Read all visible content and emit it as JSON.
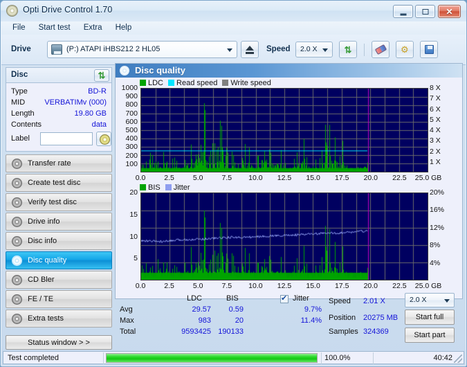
{
  "window": {
    "title": "Opti Drive Control 1.70",
    "icon": "disc-icon",
    "minimize": "minimize-icon",
    "maximize": "maximize-icon",
    "close": "✕"
  },
  "menu": {
    "items": [
      "File",
      "Start test",
      "Extra",
      "Help"
    ]
  },
  "toolbar": {
    "drive_label": "Drive",
    "drive_value": "(P:)  ATAPI iHBS212  2 HL05",
    "eject_icon": "eject-icon",
    "speed_label": "Speed",
    "speed_value": "2.0 X",
    "refresh_icon": "refresh-icon",
    "erase_icon": "erase-icon",
    "tools_icon": "tools-icon",
    "save_icon": "save-icon"
  },
  "disc": {
    "header": "Disc",
    "refresh_icon": "refresh-icon",
    "rows": [
      {
        "key": "Type",
        "value": "BD-R"
      },
      {
        "key": "MID",
        "value": "VERBATIMv (000)"
      },
      {
        "key": "Length",
        "value": "19.80 GB"
      },
      {
        "key": "Contents",
        "value": "data"
      }
    ],
    "label_key": "Label",
    "label_value": "",
    "label_placeholder": ""
  },
  "nav": {
    "items": [
      {
        "label": "Transfer rate",
        "selected": false
      },
      {
        "label": "Create test disc",
        "selected": false
      },
      {
        "label": "Verify test disc",
        "selected": false
      },
      {
        "label": "Drive info",
        "selected": false
      },
      {
        "label": "Disc info",
        "selected": false
      },
      {
        "label": "Disc quality",
        "selected": true
      },
      {
        "label": "CD Bler",
        "selected": false
      },
      {
        "label": "FE / TE",
        "selected": false
      },
      {
        "label": "Extra tests",
        "selected": false
      }
    ],
    "status_window": "Status window > >"
  },
  "panel": {
    "title": "Disc quality",
    "icon": "disc-quality-icon"
  },
  "stats": {
    "col_headers": [
      "LDC",
      "BIS",
      "Jitter"
    ],
    "jitter_checked": true,
    "rows": [
      {
        "label": "Avg",
        "ldc": "29.57",
        "bis": "0.59",
        "jitter": "9.7%"
      },
      {
        "label": "Max",
        "ldc": "983",
        "bis": "20",
        "jitter": "11.4%"
      },
      {
        "label": "Total",
        "ldc": "9593425",
        "bis": "190133",
        "jitter": ""
      }
    ],
    "right": [
      {
        "label": "Speed",
        "value": "2.01 X"
      },
      {
        "label": "Position",
        "value": "20275 MB"
      },
      {
        "label": "Samples",
        "value": "324369"
      }
    ],
    "speed_select": "2.0 X",
    "start_full": "Start full",
    "start_part": "Start part"
  },
  "statusbar": {
    "message": "Test completed",
    "percent": "100.0%",
    "progress_value": 100,
    "elapsed": "40:42"
  },
  "colors": {
    "ldc": "#00a400",
    "read_speed": "#00e5ff",
    "write_speed": "#808080",
    "bis": "#00a400",
    "jitter": "#8f9ef0",
    "plot_bg": "#000060",
    "marker": "#c000c0"
  },
  "chart_data": [
    {
      "type": "area",
      "name": "quality-chart-ldc",
      "title": "",
      "legend": [
        {
          "label": "LDC",
          "color": "#00a400"
        },
        {
          "label": "Read speed",
          "color": "#00e5ff"
        },
        {
          "label": "Write speed",
          "color": "#808080"
        }
      ],
      "legend_position": "top-left",
      "xlabel": "GB",
      "xlim": [
        0,
        25
      ],
      "xticks": [
        "0.0",
        "2.5",
        "5.0",
        "7.5",
        "10.0",
        "12.5",
        "15.0",
        "17.5",
        "20.0",
        "22.5",
        "25.0 GB"
      ],
      "ylabel_left": "LDC",
      "ylim": [
        0,
        1000
      ],
      "yticks_left": [
        "1000",
        "900",
        "800",
        "700",
        "600",
        "500",
        "400",
        "300",
        "200",
        "100"
      ],
      "ylabel_right": "Speed",
      "ylim_right": [
        0,
        8
      ],
      "yticks_right": [
        "8 X",
        "7 X",
        "6 X",
        "5 X",
        "4 X",
        "3 X",
        "2 X",
        "1 X"
      ],
      "grid": true,
      "data_end_x": 19.8,
      "marker_x": 19.8,
      "series": [
        {
          "name": "LDC",
          "color": "#00a400",
          "type": "area-spikes",
          "x": [
            0.0,
            0.25,
            0.5,
            0.75,
            1.0,
            1.25,
            1.5,
            1.75,
            2.0,
            2.25,
            2.5,
            2.75,
            3.0,
            3.25,
            3.5,
            3.75,
            4.0,
            4.25,
            4.5,
            4.75,
            5.0,
            5.25,
            5.5,
            5.75,
            6.0,
            6.25,
            6.5,
            6.75,
            7.0,
            7.25,
            7.5,
            7.75,
            8.0,
            8.25,
            8.5,
            8.75,
            9.0,
            9.25,
            9.5,
            9.75,
            10.0,
            10.25,
            10.5,
            10.75,
            11.0,
            11.25,
            11.5,
            11.75,
            12.0,
            12.25,
            12.5,
            12.75,
            13.0,
            13.25,
            13.5,
            13.75,
            14.0,
            14.25,
            14.5,
            14.75,
            15.0,
            15.25,
            15.5,
            15.75,
            16.0,
            16.25,
            16.5,
            16.75,
            17.0,
            17.25,
            17.5,
            17.75,
            18.0,
            18.25,
            18.5,
            18.75,
            19.0,
            19.25,
            19.5,
            19.8
          ],
          "values": [
            60,
            180,
            120,
            260,
            300,
            575,
            200,
            150,
            330,
            110,
            90,
            200,
            170,
            230,
            140,
            120,
            300,
            440,
            830,
            380,
            300,
            420,
            980,
            300,
            260,
            420,
            970,
            760,
            600,
            590,
            710,
            430,
            220,
            130,
            90,
            180,
            260,
            580,
            230,
            300,
            180,
            200,
            220,
            420,
            330,
            250,
            430,
            360,
            290,
            400,
            430,
            200,
            140,
            290,
            330,
            180,
            420,
            500,
            180,
            90,
            120,
            180,
            390,
            250,
            720,
            520,
            680,
            560,
            480,
            500,
            430,
            300,
            140,
            90,
            60,
            80,
            120,
            160,
            200,
            120
          ]
        },
        {
          "name": "Read speed",
          "color": "#00e5ff",
          "type": "line",
          "constant_value_x": 2.01,
          "x": [
            0.0,
            19.8
          ],
          "values": [
            2.01,
            2.01
          ]
        },
        {
          "name": "Write speed",
          "color": "#808080",
          "type": "line",
          "x": [],
          "values": []
        }
      ]
    },
    {
      "type": "area",
      "name": "quality-chart-bis",
      "title": "",
      "legend": [
        {
          "label": "BIS",
          "color": "#00a400"
        },
        {
          "label": "Jitter",
          "color": "#8f9ef0"
        }
      ],
      "legend_position": "top-left",
      "xlabel": "GB",
      "xlim": [
        0,
        25
      ],
      "xticks": [
        "0.0",
        "2.5",
        "5.0",
        "7.5",
        "10.0",
        "12.5",
        "15.0",
        "17.5",
        "20.0",
        "22.5",
        "25.0 GB"
      ],
      "ylabel_left": "BIS",
      "ylim": [
        0,
        20
      ],
      "yticks_left": [
        "20",
        "15",
        "10",
        "5"
      ],
      "ylabel_right": "Jitter",
      "ylim_right": [
        0,
        20
      ],
      "yticks_right": [
        "20%",
        "16%",
        "12%",
        "8%",
        "4%"
      ],
      "grid": true,
      "data_end_x": 19.8,
      "marker_x": 19.8,
      "series": [
        {
          "name": "BIS",
          "color": "#00a400",
          "type": "area-spikes",
          "x": [
            0.0,
            0.25,
            0.5,
            0.75,
            1.0,
            1.25,
            1.5,
            1.75,
            2.0,
            2.25,
            2.5,
            2.75,
            3.0,
            3.25,
            3.5,
            3.75,
            4.0,
            4.25,
            4.5,
            4.75,
            5.0,
            5.25,
            5.5,
            5.75,
            6.0,
            6.25,
            6.5,
            6.75,
            7.0,
            7.25,
            7.5,
            7.75,
            8.0,
            8.25,
            8.5,
            8.75,
            9.0,
            9.25,
            9.5,
            9.75,
            10.0,
            10.25,
            10.5,
            10.75,
            11.0,
            11.25,
            11.5,
            11.75,
            12.0,
            12.25,
            12.5,
            12.75,
            13.0,
            13.25,
            13.5,
            13.75,
            14.0,
            14.25,
            14.5,
            14.75,
            15.0,
            15.25,
            15.5,
            15.75,
            16.0,
            16.25,
            16.5,
            16.75,
            17.0,
            17.25,
            17.5,
            17.75,
            18.0,
            18.25,
            18.5,
            18.75,
            19.0,
            19.25,
            19.5,
            19.8
          ],
          "values": [
            3,
            5,
            4,
            3,
            5,
            6,
            12,
            4,
            5,
            4,
            3,
            3,
            4,
            5,
            3,
            4,
            6,
            11,
            18,
            7,
            6,
            8,
            19,
            6,
            5,
            7,
            20,
            16,
            13,
            12,
            15,
            10,
            6,
            4,
            3,
            4,
            6,
            12,
            5,
            6,
            4,
            4,
            5,
            8,
            7,
            5,
            9,
            7,
            6,
            8,
            9,
            4,
            3,
            6,
            7,
            4,
            8,
            10,
            4,
            3,
            3,
            4,
            8,
            5,
            16,
            11,
            14,
            12,
            10,
            11,
            9,
            6,
            3,
            3,
            2,
            2,
            3,
            4,
            5,
            3
          ]
        },
        {
          "name": "Jitter",
          "color": "#8f9ef0",
          "type": "line",
          "x": [
            0.0,
            1.0,
            2.0,
            3.0,
            4.0,
            5.0,
            6.0,
            7.0,
            8.0,
            9.0,
            10.0,
            11.0,
            12.0,
            13.0,
            14.0,
            15.0,
            16.0,
            17.0,
            18.0,
            19.0,
            19.8
          ],
          "values": [
            9.0,
            8.9,
            8.8,
            9.1,
            9.3,
            9.4,
            9.5,
            9.7,
            9.8,
            9.8,
            9.9,
            10.1,
            10.2,
            10.3,
            10.4,
            10.6,
            10.7,
            10.8,
            10.9,
            11.2,
            11.2
          ]
        }
      ]
    }
  ]
}
